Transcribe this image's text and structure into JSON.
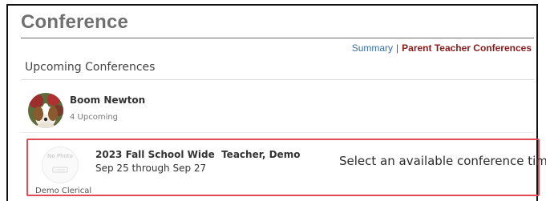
{
  "header": {
    "title": "Conference"
  },
  "nav": {
    "summary_label": "Summary",
    "separator": "|",
    "ptc_label": "Parent Teacher Conferences"
  },
  "section": {
    "title": "Upcoming Conferences"
  },
  "student": {
    "name": "Boom Newton",
    "upcoming_text": "4 Upcoming"
  },
  "conference": {
    "title": "2023 Fall School Wide  Teacher, Demo",
    "dates": "Sep 25 through Sep 27",
    "action_text": "Select an available conference time",
    "teacher_photo_text": "No Photo",
    "teacher_caption": "Demo Clerical"
  },
  "colors": {
    "highlight": "#e04b55",
    "link": "#3a6ea5",
    "active_link": "#8b1a1a"
  }
}
